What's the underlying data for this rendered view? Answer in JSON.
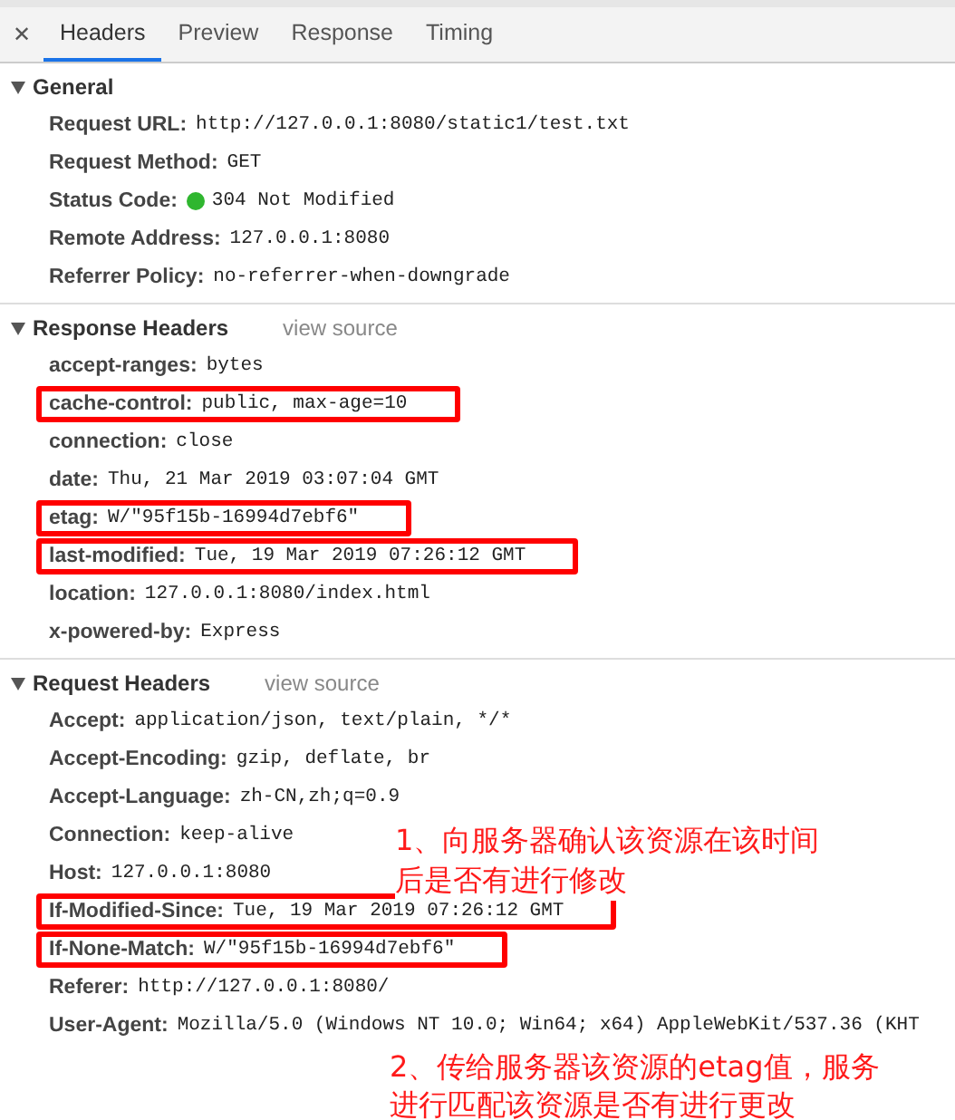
{
  "close": "✕",
  "tabs": [
    {
      "label": "Headers",
      "selected": true
    },
    {
      "label": "Preview",
      "selected": false
    },
    {
      "label": "Response",
      "selected": false
    },
    {
      "label": "Timing",
      "selected": false
    }
  ],
  "sections": [
    {
      "title": "General",
      "expanded": true,
      "headers": [
        {
          "name": "Request URL:",
          "value": "http://127.0.0.1:8080/static1/test.txt",
          "highlighted": false
        },
        {
          "name": "Request Method:",
          "value": "GET",
          "highlighted": false
        },
        {
          "name": "Status Code:",
          "value": "304 Not Modified",
          "highlighted": false,
          "color": "#2fb62f"
        },
        {
          "name": "Remote Address:",
          "value": "127.0.0.1:8080",
          "highlighted": false
        },
        {
          "name": "Referrer Policy:",
          "value": "no-referrer-when-downgrade",
          "highlighted": false
        }
      ]
    },
    {
      "title": "Response Headers",
      "link": "view source",
      "expanded": true,
      "headers": [
        {
          "name": "accept-ranges:",
          "value": "bytes",
          "highlighted": false
        },
        {
          "name": "cache-control:",
          "value": "public, max-age=10",
          "highlighted": true
        },
        {
          "name": "connection:",
          "value": "close",
          "highlighted": false
        },
        {
          "name": "date:",
          "value": "Thu, 21 Mar 2019 03:07:04 GMT",
          "highlighted": false
        },
        {
          "name": "etag:",
          "value": "W/\"95f15b-16994d7ebf6\"",
          "highlighted": true
        },
        {
          "name": "last-modified:",
          "value": "Tue, 19 Mar 2019 07:26:12 GMT",
          "highlighted": true
        },
        {
          "name": "location:",
          "value": "127.0.0.1:8080/index.html",
          "highlighted": false
        },
        {
          "name": "x-powered-by:",
          "value": "Express",
          "highlighted": false
        }
      ]
    },
    {
      "title": "Request Headers",
      "link": "view source",
      "expanded": true,
      "headers": [
        {
          "name": "Accept:",
          "value": "application/json, text/plain, */*",
          "highlighted": false
        },
        {
          "name": "Accept-Encoding:",
          "value": "gzip, deflate, br",
          "highlighted": false
        },
        {
          "name": "Accept-Language:",
          "value": "zh-CN,zh;q=0.9",
          "highlighted": false
        },
        {
          "name": "Connection:",
          "value": "keep-alive",
          "highlighted": false
        },
        {
          "name": "Host:",
          "value": "127.0.0.1:8080",
          "highlighted": false
        },
        {
          "name": "If-Modified-Since:",
          "value": "Tue, 19 Mar 2019 07:26:12 GMT",
          "highlighted": true
        },
        {
          "name": "If-None-Match:",
          "value": "W/\"95f15b-16994d7ebf6\"",
          "highlighted": true
        },
        {
          "name": "Referer:",
          "value": "http://127.0.0.1:8080/",
          "highlighted": false
        },
        {
          "name": "User-Agent:",
          "value": "Mozilla/5.0 (Windows NT 10.0; Win64; x64) AppleWebKit/537.36 (KHT",
          "highlighted": false
        }
      ],
      "annotations": [
        "1、向服务器确认该资源在该时间后是否有进行修改",
        "2、传给服务器该资源的etag值，服务进行匹配该资源是否有进行更改"
      ]
    }
  ]
}
